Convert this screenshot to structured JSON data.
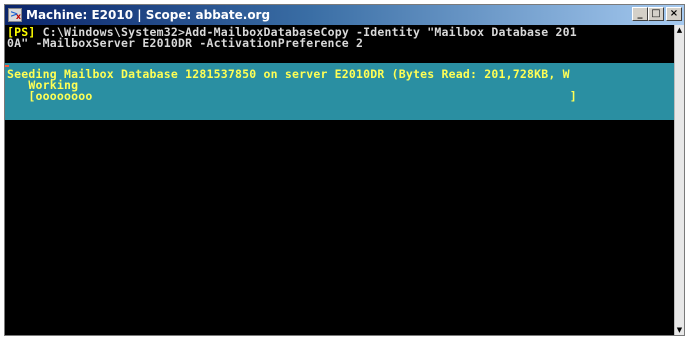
{
  "window": {
    "title": "Machine: E2010 | Scope: abbate.org",
    "icon": "powershell-icon",
    "buttons": {
      "minimize": "_",
      "maximize": "□",
      "close": "×"
    }
  },
  "console": {
    "prompt_tag": "[PS]",
    "command_line_1": " C:\\Windows\\System32>Add-MailboxDatabaseCopy -Identity \"Mailbox Database 201",
    "command_line_2": "0A\" -MailboxServer E2010DR -ActivationPreference 2"
  },
  "progress": {
    "activity": "Seeding Mailbox Database 1281537850 on server E2010DR (Bytes Read: 201,728KB, W",
    "status": "Working",
    "bar": "[oooooooo                                                                   ]"
  },
  "colors": {
    "console_bg": "#000000",
    "progress_bg": "#2a8fa2",
    "progress_text": "#ffff55",
    "prompt_tag": "#ffff00",
    "console_text": "#d8d8d8"
  }
}
